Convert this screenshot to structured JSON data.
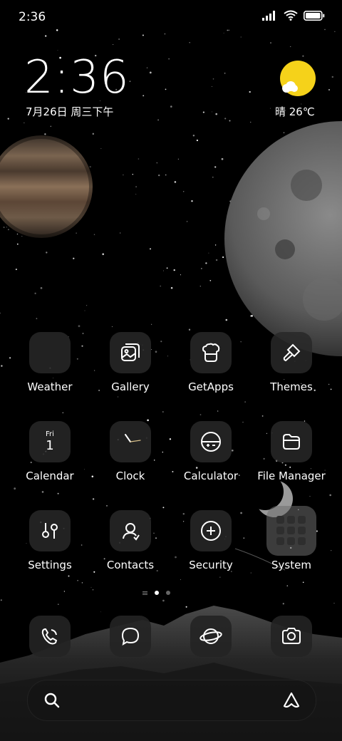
{
  "status_bar": {
    "time": "2:36"
  },
  "lockclock": {
    "time": "2:36",
    "date": "7月26日 周三下午"
  },
  "weather_widget": {
    "text": "晴 26℃"
  },
  "apps": [
    {
      "label": "Weather",
      "icon": "weather-icon"
    },
    {
      "label": "Gallery",
      "icon": "gallery-icon"
    },
    {
      "label": "GetApps",
      "icon": "getapps-icon"
    },
    {
      "label": "Themes",
      "icon": "themes-icon"
    },
    {
      "label": "Calendar",
      "icon": "calendar-icon",
      "day": "Fri",
      "date": "1"
    },
    {
      "label": "Clock",
      "icon": "clock-icon"
    },
    {
      "label": "Calculator",
      "icon": "calculator-icon"
    },
    {
      "label": "File Manager",
      "icon": "folder-icon"
    },
    {
      "label": "Settings",
      "icon": "settings-icon"
    },
    {
      "label": "Contacts",
      "icon": "contacts-icon"
    },
    {
      "label": "Security",
      "icon": "security-icon"
    },
    {
      "label": "System",
      "icon": "folder-grid-icon"
    }
  ],
  "dock": [
    {
      "icon": "phone-icon"
    },
    {
      "icon": "messages-icon"
    },
    {
      "icon": "browser-icon"
    },
    {
      "icon": "camera-icon"
    }
  ],
  "page_indicator": {
    "pages": 2,
    "current": 1
  },
  "colors": {
    "sun": "#f5d21a",
    "background": "#000000",
    "tile": "#282828"
  }
}
